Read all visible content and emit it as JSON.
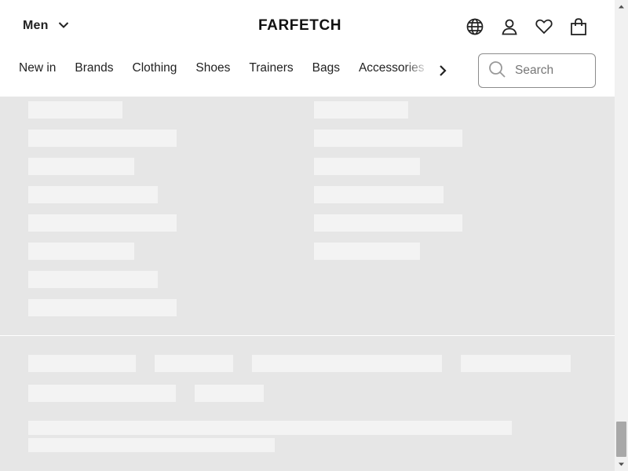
{
  "header": {
    "department": "Men",
    "logo": "FARFETCH",
    "icons": [
      "globe-icon",
      "account-icon",
      "wishlist-heart-icon",
      "shopping-bag-icon"
    ]
  },
  "nav": {
    "items": [
      "New in",
      "Brands",
      "Clothing",
      "Shoes",
      "Trainers",
      "Bags",
      "Accessories"
    ]
  },
  "search": {
    "placeholder": "Search"
  },
  "colors": {
    "page_background": "#e6e6e6",
    "skeleton_block": "#f3f3f3",
    "header_background": "#ffffff",
    "text": "#222222"
  }
}
